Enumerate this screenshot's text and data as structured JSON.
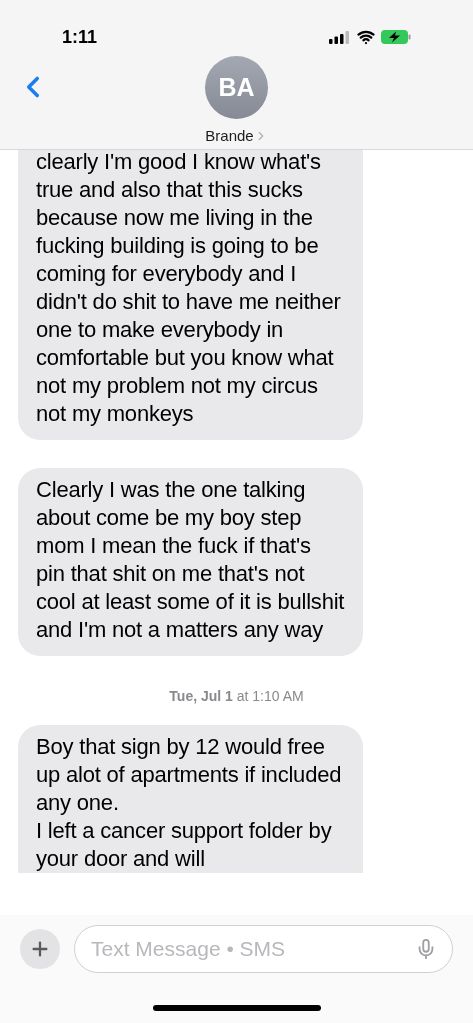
{
  "status_bar": {
    "time": "1:11"
  },
  "header": {
    "initials": "BA",
    "name": "Brande"
  },
  "messages": [
    {
      "kind": "bubble",
      "text": "clearly I'm good I know what's true and also that this sucks because now me living in the fucking building is going to be coming for everybody and I didn't do shit to have me neither one to make everybody in comfortable but you know what not my problem not my circus not my monkeys"
    },
    {
      "kind": "bubble",
      "text": "Clearly I was the one talking about come be my boy step mom I mean the fuck if that's pin that shit on me that's not cool at least some of it is bullshit and I'm not a matters any way"
    },
    {
      "kind": "timestamp",
      "day": "Tue, Jul 1",
      "time": "at 1:10 AM"
    },
    {
      "kind": "bubble",
      "text": "Boy that sign by 12 would free up alot of apartments if included any one.\nI left a cancer support folder by your door and will"
    }
  ],
  "composer": {
    "placeholder": "Text Message • SMS"
  }
}
